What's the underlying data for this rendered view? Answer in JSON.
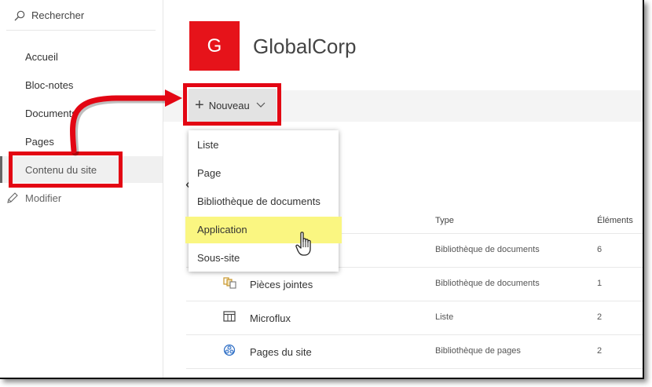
{
  "sidebar": {
    "search_label": "Rechercher",
    "items": [
      {
        "label": "Accueil"
      },
      {
        "label": "Bloc-notes"
      },
      {
        "label": "Documents"
      },
      {
        "label": "Pages"
      },
      {
        "label": "Contenu du site",
        "active": true
      }
    ],
    "edit_label": "Modifier"
  },
  "header": {
    "logo_letter": "G",
    "site_title": "GlobalCorp"
  },
  "commandbar": {
    "new_label": "Nouveau"
  },
  "new_menu": {
    "items": [
      {
        "label": "Liste"
      },
      {
        "label": "Page"
      },
      {
        "label": "Bibliothèque de documents"
      },
      {
        "label": "Application",
        "highlighted": true
      },
      {
        "label": "Sous-site"
      }
    ]
  },
  "table": {
    "columns": [
      "Type",
      "Éléments"
    ],
    "rows": [
      {
        "name": "",
        "type": "Bibliothèque de documents",
        "count": "6",
        "icon": "document-library-icon"
      },
      {
        "name": "Pièces jointes",
        "type": "Bibliothèque de documents",
        "count": "1",
        "icon": "attachments-library-icon"
      },
      {
        "name": "Microflux",
        "type": "Liste",
        "count": "2",
        "icon": "list-icon"
      },
      {
        "name": "Pages du site",
        "type": "Bibliothèque de pages",
        "count": "2",
        "icon": "site-pages-icon"
      }
    ]
  },
  "colors": {
    "accent": "#e6131a",
    "annotation": "#e30613",
    "highlight": "#faf681"
  }
}
